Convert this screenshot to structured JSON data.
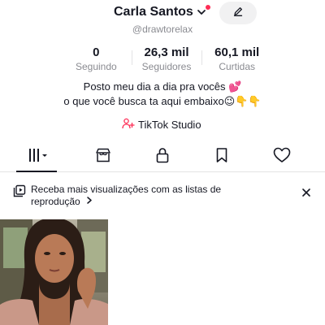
{
  "profile": {
    "name": "Carla Santos",
    "handle": "@drawtorelax"
  },
  "stats": [
    {
      "value": "0",
      "label": "Seguindo"
    },
    {
      "value": "26,3 mil",
      "label": "Seguidores"
    },
    {
      "value": "60,1 mil",
      "label": "Curtidas"
    }
  ],
  "bio": {
    "line1": "Posto meu dia a dia pra vocês 💕",
    "line2": "o que você busca ta aqui embaixo😉👇👇"
  },
  "studio": {
    "label": "TikTok Studio"
  },
  "tabs": [
    {
      "icon": "grid-icon",
      "active": true
    },
    {
      "icon": "shop-icon",
      "active": false
    },
    {
      "icon": "lock-icon",
      "active": false
    },
    {
      "icon": "bookmark-icon",
      "active": false
    },
    {
      "icon": "heart-icon",
      "active": false
    }
  ],
  "banner": {
    "text": "Receba mais visualizações com as listas de reprodução"
  },
  "colors": {
    "accent": "#fe2c55",
    "text": "#161823",
    "muted": "#8a8b91"
  }
}
